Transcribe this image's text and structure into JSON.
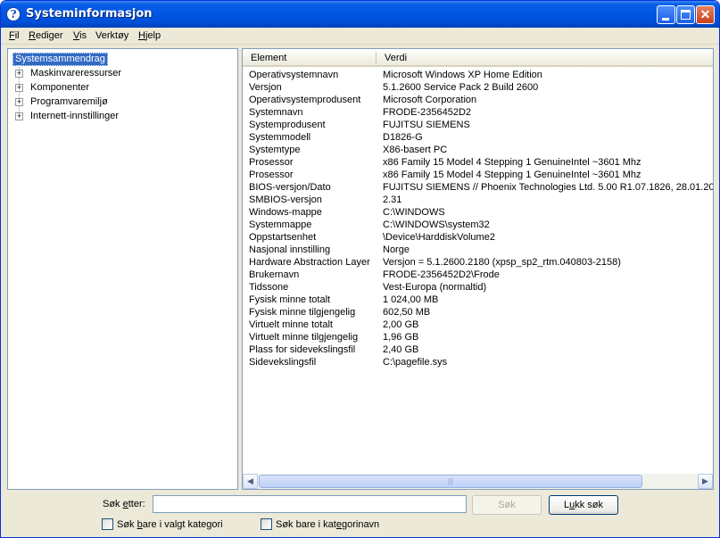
{
  "window": {
    "title": "Systeminformasjon",
    "icon": "help-icon"
  },
  "menubar": {
    "items": [
      {
        "label": "Fil",
        "mnemonic_index": 0
      },
      {
        "label": "Rediger",
        "mnemonic_index": 0
      },
      {
        "label": "Vis",
        "mnemonic_index": 0
      },
      {
        "label": "Verktøy",
        "mnemonic_index": -1
      },
      {
        "label": "Hjelp",
        "mnemonic_index": 0
      }
    ]
  },
  "tree": {
    "root": "Systemsammendrag",
    "children": [
      "Maskinvareressurser",
      "Komponenter",
      "Programvaremiljø",
      "Internett-innstillinger"
    ],
    "expander_symbol": "+"
  },
  "list": {
    "columns": [
      "Element",
      "Verdi"
    ],
    "rows": [
      [
        "Operativsystemnavn",
        "Microsoft Windows XP Home Edition"
      ],
      [
        "Versjon",
        "5.1.2600 Service Pack 2 Build 2600"
      ],
      [
        "Operativsystemprodusent",
        "Microsoft Corporation"
      ],
      [
        "Systemnavn",
        "FRODE-2356452D2"
      ],
      [
        "Systemprodusent",
        "FUJITSU SIEMENS"
      ],
      [
        "Systemmodell",
        "D1826-G"
      ],
      [
        "Systemtype",
        "X86-basert PC"
      ],
      [
        "Prosessor",
        "x86 Family 15 Model 4 Stepping 1 GenuineIntel ~3601 Mhz"
      ],
      [
        "Prosessor",
        "x86 Family 15 Model 4 Stepping 1 GenuineIntel ~3601 Mhz"
      ],
      [
        "BIOS-versjon/Dato",
        "FUJITSU SIEMENS // Phoenix Technologies Ltd. 5.00 R1.07.1826, 28.01.20"
      ],
      [
        "SMBIOS-versjon",
        "2.31"
      ],
      [
        "Windows-mappe",
        "C:\\WINDOWS"
      ],
      [
        "Systemmappe",
        "C:\\WINDOWS\\system32"
      ],
      [
        "Oppstartsenhet",
        "\\Device\\HarddiskVolume2"
      ],
      [
        "Nasjonal innstilling",
        "Norge"
      ],
      [
        "Hardware Abstraction Layer",
        "Versjon = 5.1.2600.2180 (xpsp_sp2_rtm.040803-2158)"
      ],
      [
        "Brukernavn",
        "FRODE-2356452D2\\Frode"
      ],
      [
        "Tidssone",
        "Vest-Europa (normaltid)"
      ],
      [
        "Fysisk minne totalt",
        "1 024,00 MB"
      ],
      [
        "Fysisk minne tilgjengelig",
        "602,50 MB"
      ],
      [
        "Virtuelt minne totalt",
        "2,00 GB"
      ],
      [
        "Virtuelt minne tilgjengelig",
        "1,96 GB"
      ],
      [
        "Plass for sidevekslingsfil",
        "2,40 GB"
      ],
      [
        "Sidevekslingsfil",
        "C:\\pagefile.sys"
      ]
    ]
  },
  "search": {
    "label": "Søk etter:",
    "value": "",
    "search_button": "Søk",
    "close_button": "Lukk søk",
    "checkbox_selected_category": "Søk bare i valgt kategori",
    "checkbox_category_names": "Søk bare i kategorinavn",
    "checkbox_selected_category_checked": false,
    "checkbox_category_names_checked": false
  },
  "scrollbar": {
    "left_arrow": "◀",
    "right_arrow": "▶",
    "grip": "|||"
  },
  "colors": {
    "titlebar": "#0054e3",
    "selection": "#316ac5",
    "panel_border": "#7f9db9"
  }
}
